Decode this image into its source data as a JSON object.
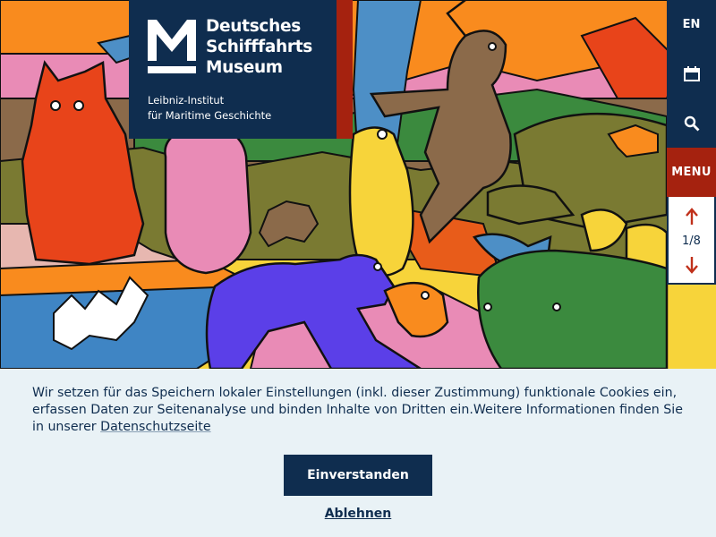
{
  "header": {
    "logo_line1": "Deutsches",
    "logo_line2": "Schifffahrts",
    "logo_line3": "Museum",
    "subtitle_line1": "Leibniz-Institut",
    "subtitle_line2": "für Maritime Geschichte"
  },
  "toolbar": {
    "language_label": "EN",
    "calendar_icon": "calendar-icon",
    "search_icon": "search-icon",
    "menu_label": "MENU",
    "slider": {
      "prev_icon": "arrow-up-icon",
      "current": "1",
      "separator": "/",
      "total": "8",
      "count_text": "1/8",
      "next_icon": "arrow-down-icon"
    }
  },
  "cookie_banner": {
    "text_before_link": "Wir setzen für das Speichern lokaler Einstellungen (inkl. dieser Zustimmung) funktionale Cookies ein, erfassen Daten zur Seitenanalyse und binden Inhalte von Dritten ein.Weitere Informationen finden Sie in unserer ",
    "link_label": "Datenschutzseite",
    "accept_label": "Einverstanden",
    "decline_label": "Ablehnen"
  },
  "colors": {
    "navy": "#0f2d4f",
    "red": "#a5220f",
    "banner_bg": "#e9f2f6"
  }
}
